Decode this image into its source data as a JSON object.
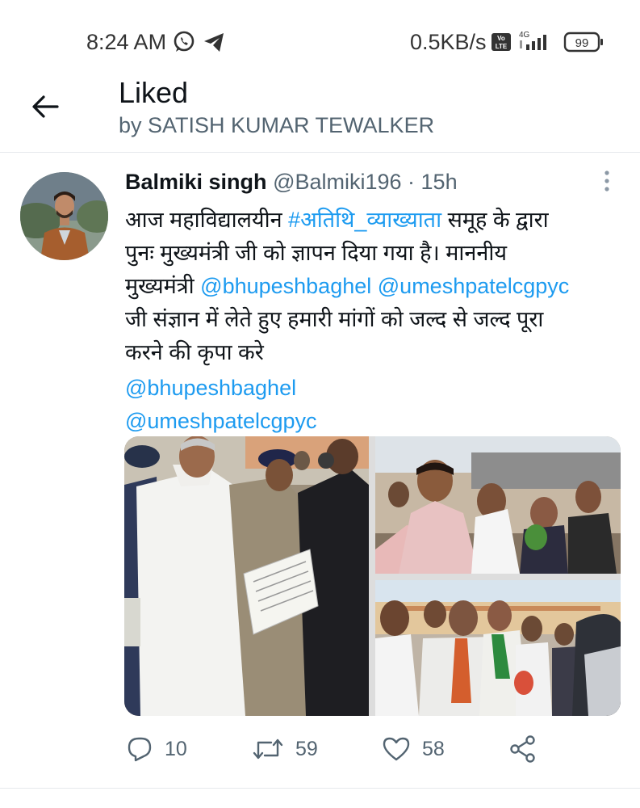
{
  "status_bar": {
    "time": "8:24 AM",
    "net_speed": "0.5KB/s",
    "network_type": "4G",
    "volte": "Vo LTE",
    "battery": "99"
  },
  "header": {
    "title": "Liked",
    "subtitle": "by SATISH KUMAR TEWALKER"
  },
  "tweet": {
    "author_name": "Balmiki singh",
    "handle": "@Balmiki196",
    "separator": " · ",
    "time_ago": "15h",
    "text": {
      "line1_a": "आज महाविद्यालयीन ",
      "line1_hashtag": "#अतिथि_व्याख्याता",
      "line1_b": " समूह के द्वारा",
      "line2": "पुनः मुख्यमंत्री जी को ज्ञापन दिया गया है। माननीय",
      "line3_a": "मुख्यमंत्री ",
      "line3_m1": "@bhupeshbaghel",
      "line3_space": " ",
      "line3_m2": "@umeshpatelcgpyc",
      "line4": "जी संज्ञान में लेते हुए हमारी मांगों को जल्द से जल्द पूरा",
      "line5": "करने की कृपा करे",
      "mention1": "@bhupeshbaghel",
      "mention2": "@umeshpatelcgpyc"
    },
    "actions": {
      "replies": "10",
      "retweets": "59",
      "likes": "58"
    }
  },
  "colors": {
    "link": "#1d9bf0",
    "secondary_text": "#536471",
    "primary_text": "#0f1419",
    "divider": "#e6e9ec"
  },
  "icons": [
    "back-arrow-icon",
    "whatsapp-icon",
    "telegram-icon",
    "volte-icon",
    "signal-icon",
    "battery-icon",
    "more-vertical-icon",
    "reply-icon",
    "retweet-icon",
    "like-icon",
    "share-icon"
  ]
}
